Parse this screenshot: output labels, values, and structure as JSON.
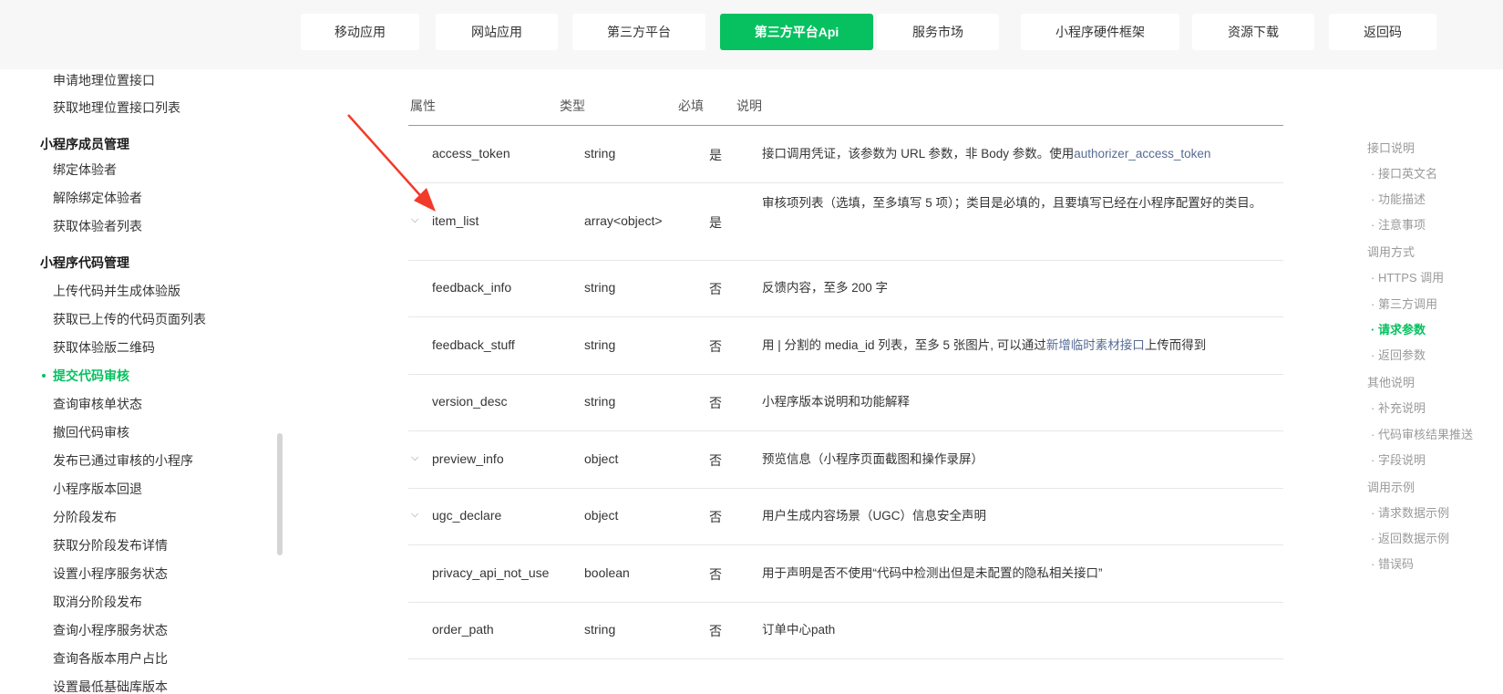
{
  "topnav": {
    "items": [
      {
        "label": "移动应用",
        "active": false
      },
      {
        "label": "网站应用",
        "active": false
      },
      {
        "label": "第三方平台",
        "active": false
      },
      {
        "label": "第三方平台Api",
        "active": true
      },
      {
        "label": "服务市场",
        "active": false
      },
      {
        "label": "小程序硬件框架",
        "active": false
      },
      {
        "label": "资源下载",
        "active": false
      },
      {
        "label": "返回码",
        "active": false
      }
    ]
  },
  "sidebar": {
    "items": [
      {
        "type": "item",
        "label": "申请地理位置接口"
      },
      {
        "type": "item",
        "label": "获取地理位置接口列表"
      },
      {
        "type": "group",
        "label": "小程序成员管理"
      },
      {
        "type": "item",
        "label": "绑定体验者"
      },
      {
        "type": "item",
        "label": "解除绑定体验者"
      },
      {
        "type": "item",
        "label": "获取体验者列表"
      },
      {
        "type": "group",
        "label": "小程序代码管理"
      },
      {
        "type": "item",
        "label": "上传代码并生成体验版"
      },
      {
        "type": "item",
        "label": "获取已上传的代码页面列表"
      },
      {
        "type": "item",
        "label": "获取体验版二维码"
      },
      {
        "type": "item",
        "label": "提交代码审核",
        "active": true
      },
      {
        "type": "item",
        "label": "查询审核单状态"
      },
      {
        "type": "item",
        "label": "撤回代码审核"
      },
      {
        "type": "item",
        "label": "发布已通过审核的小程序"
      },
      {
        "type": "item",
        "label": "小程序版本回退"
      },
      {
        "type": "item",
        "label": "分阶段发布"
      },
      {
        "type": "item",
        "label": "获取分阶段发布详情"
      },
      {
        "type": "item",
        "label": "设置小程序服务状态"
      },
      {
        "type": "item",
        "label": "取消分阶段发布"
      },
      {
        "type": "item",
        "label": "查询小程序服务状态"
      },
      {
        "type": "item",
        "label": "查询各版本用户占比"
      },
      {
        "type": "item",
        "label": "设置最低基础库版本"
      }
    ]
  },
  "table": {
    "headers": [
      "属性",
      "类型",
      "必填",
      "说明"
    ],
    "rows": [
      {
        "name": "access_token",
        "type": "string",
        "required": "是",
        "desc": "接口调用凭证，该参数为 URL 参数，非 Body 参数。使用",
        "desc_link": "authorizer_access_token",
        "desc_after": "",
        "expandable": false
      },
      {
        "name": "item_list",
        "type": "array<object>",
        "required": "是",
        "desc": "审核项列表（选填，至多填写 5 项）；类目是必填的，且要填写已经在小程序配置好的类目。",
        "desc_link": "",
        "desc_after": "",
        "expandable": true
      },
      {
        "name": "feedback_info",
        "type": "string",
        "required": "否",
        "desc": "反馈内容，至多 200 字",
        "desc_link": "",
        "desc_after": "",
        "expandable": false
      },
      {
        "name": "feedback_stuff",
        "type": "string",
        "required": "否",
        "desc": "用 | 分割的 media_id 列表，至多 5 张图片, 可以通过",
        "desc_link": "新增临时素材接口",
        "desc_after": "上传而得到",
        "expandable": false
      },
      {
        "name": "version_desc",
        "type": "string",
        "required": "否",
        "desc": "小程序版本说明和功能解释",
        "desc_link": "",
        "desc_after": "",
        "expandable": false
      },
      {
        "name": "preview_info",
        "type": "object",
        "required": "否",
        "desc": "预览信息（小程序页面截图和操作录屏）",
        "desc_link": "",
        "desc_after": "",
        "expandable": true
      },
      {
        "name": "ugc_declare",
        "type": "object",
        "required": "否",
        "desc": "用户生成内容场景（UGC）信息安全声明",
        "desc_link": "",
        "desc_after": "",
        "expandable": true
      },
      {
        "name": "privacy_api_not_use",
        "type": "boolean",
        "required": "否",
        "desc": "用于声明是否不使用“代码中检测出但是未配置的隐私相关接口”",
        "desc_link": "",
        "desc_after": "",
        "expandable": false
      },
      {
        "name": "order_path",
        "type": "string",
        "required": "否",
        "desc": "订单中心path",
        "desc_link": "",
        "desc_after": "",
        "expandable": false
      }
    ]
  },
  "toc": {
    "items": [
      {
        "label": "接口说明",
        "level": 1
      },
      {
        "label": "· 接口英文名",
        "level": 2
      },
      {
        "label": "· 功能描述",
        "level": 2
      },
      {
        "label": "· 注意事项",
        "level": 2
      },
      {
        "label": "调用方式",
        "level": 1
      },
      {
        "label": "· HTTPS 调用",
        "level": 2
      },
      {
        "label": "· 第三方调用",
        "level": 2
      },
      {
        "label": "· 请求参数",
        "level": 2,
        "active": true
      },
      {
        "label": "· 返回参数",
        "level": 2
      },
      {
        "label": "其他说明",
        "level": 1
      },
      {
        "label": "· 补充说明",
        "level": 2
      },
      {
        "label": "· 代码审核结果推送",
        "level": 2
      },
      {
        "label": "· 字段说明",
        "level": 2
      },
      {
        "label": "调用示例",
        "level": 1
      },
      {
        "label": "· 请求数据示例",
        "level": 2
      },
      {
        "label": "· 返回数据示例",
        "level": 2
      },
      {
        "label": "· 错误码",
        "level": 2
      }
    ]
  },
  "colors": {
    "accent": "#07c160",
    "link": "#576b95",
    "annotation_arrow": "#f23a2a"
  }
}
